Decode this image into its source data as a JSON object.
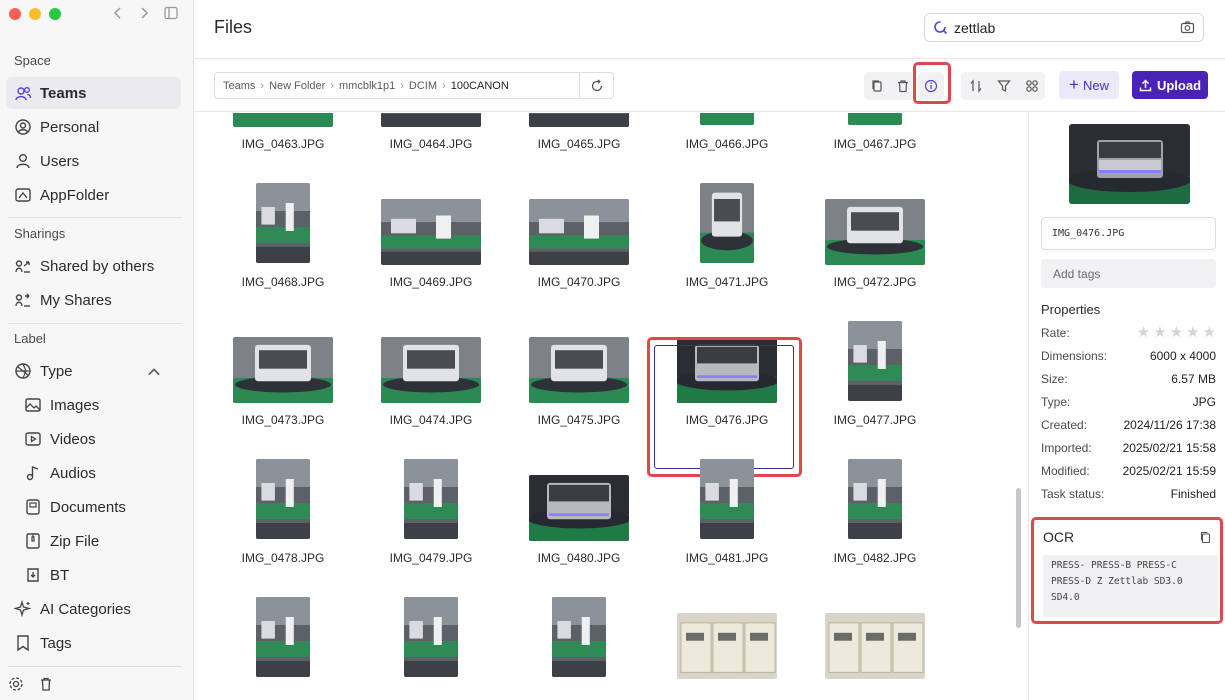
{
  "window": {
    "traffic_colors": [
      "#ff5f57",
      "#febc2e",
      "#28c840"
    ]
  },
  "sidebar": {
    "sections": {
      "space": "Space",
      "sharings": "Sharings",
      "label": "Label"
    },
    "space_items": [
      {
        "label": "Teams",
        "icon": "teams-icon",
        "active": true
      },
      {
        "label": "Personal",
        "icon": "personal-icon"
      },
      {
        "label": "Users",
        "icon": "users-icon"
      },
      {
        "label": "AppFolder",
        "icon": "appfolder-icon"
      }
    ],
    "sharing_items": [
      {
        "label": "Shared by others",
        "icon": "shared-icon"
      },
      {
        "label": "My Shares",
        "icon": "my-shares-icon"
      }
    ],
    "label_items": [
      {
        "label": "Type",
        "icon": "type-icon"
      },
      {
        "label": "Images",
        "icon": "images-icon"
      },
      {
        "label": "Videos",
        "icon": "videos-icon"
      },
      {
        "label": "Audios",
        "icon": "audios-icon"
      },
      {
        "label": "Documents",
        "icon": "documents-icon"
      },
      {
        "label": "Zip File",
        "icon": "zip-icon"
      },
      {
        "label": "BT",
        "icon": "bt-icon"
      },
      {
        "label": "AI Categories",
        "icon": "ai-icon"
      },
      {
        "label": "Tags",
        "icon": "tags-icon"
      }
    ]
  },
  "header": {
    "title": "Files",
    "search_value": "zettlab"
  },
  "toolbar": {
    "breadcrumb": [
      "Teams",
      "New Folder",
      "mmcblk1p1",
      "DCIM",
      "100CANON"
    ],
    "new_label": "New",
    "upload_label": "Upload",
    "highlight_color": "#e0474c",
    "accent": "#4b22b8"
  },
  "files": [
    {
      "name": "IMG_0463.JPG",
      "kind": "land",
      "tone": "machine"
    },
    {
      "name": "IMG_0464.JPG",
      "kind": "land",
      "tone": "line"
    },
    {
      "name": "IMG_0465.JPG",
      "kind": "land",
      "tone": "line"
    },
    {
      "name": "IMG_0466.JPG",
      "kind": "port",
      "tone": "device"
    },
    {
      "name": "IMG_0467.JPG",
      "kind": "port",
      "tone": "device"
    },
    {
      "name": "IMG_0468.JPG",
      "kind": "port",
      "tone": "line"
    },
    {
      "name": "IMG_0469.JPG",
      "kind": "land",
      "tone": "line"
    },
    {
      "name": "IMG_0470.JPG",
      "kind": "land",
      "tone": "line"
    },
    {
      "name": "IMG_0471.JPG",
      "kind": "port",
      "tone": "device"
    },
    {
      "name": "IMG_0472.JPG",
      "kind": "land",
      "tone": "device"
    },
    {
      "name": "IMG_0473.JPG",
      "kind": "land",
      "tone": "device"
    },
    {
      "name": "IMG_0474.JPG",
      "kind": "land",
      "tone": "device"
    },
    {
      "name": "IMG_0475.JPG",
      "kind": "land",
      "tone": "device"
    },
    {
      "name": "IMG_0476.JPG",
      "kind": "land",
      "tone": "dark",
      "selected": true
    },
    {
      "name": "IMG_0477.JPG",
      "kind": "port",
      "tone": "line"
    },
    {
      "name": "IMG_0478.JPG",
      "kind": "port",
      "tone": "line"
    },
    {
      "name": "IMG_0479.JPG",
      "kind": "port",
      "tone": "line"
    },
    {
      "name": "IMG_0480.JPG",
      "kind": "land",
      "tone": "dark"
    },
    {
      "name": "IMG_0481.JPG",
      "kind": "port",
      "tone": "line"
    },
    {
      "name": "IMG_0482.JPG",
      "kind": "port",
      "tone": "line"
    },
    {
      "name": "",
      "kind": "port",
      "tone": "line"
    },
    {
      "name": "",
      "kind": "port",
      "tone": "line"
    },
    {
      "name": "",
      "kind": "port",
      "tone": "line"
    },
    {
      "name": "",
      "kind": "land",
      "tone": "boxes"
    },
    {
      "name": "",
      "kind": "land",
      "tone": "boxes"
    }
  ],
  "detail": {
    "file_name": "IMG_0476.JPG",
    "tags_placeholder": "Add tags",
    "properties_title": "Properties",
    "properties": [
      {
        "k": "Rate:",
        "v": ""
      },
      {
        "k": "Dimensions:",
        "v": "6000 x 4000"
      },
      {
        "k": "Size:",
        "v": "6.57 MB"
      },
      {
        "k": "Type:",
        "v": "JPG"
      },
      {
        "k": "Created:",
        "v": "2024/11/26 17:38"
      },
      {
        "k": "Imported:",
        "v": "2025/02/21 15:58"
      },
      {
        "k": "Modified:",
        "v": "2025/02/21 15:59"
      },
      {
        "k": "Task status:",
        "v": "Finished"
      }
    ],
    "rating": 0,
    "ocr_title": "OCR",
    "ocr_text": "PRESS- PRESS-B PRESS-C PRESS-D Z Zettlab SD3.0 SD4.0"
  }
}
